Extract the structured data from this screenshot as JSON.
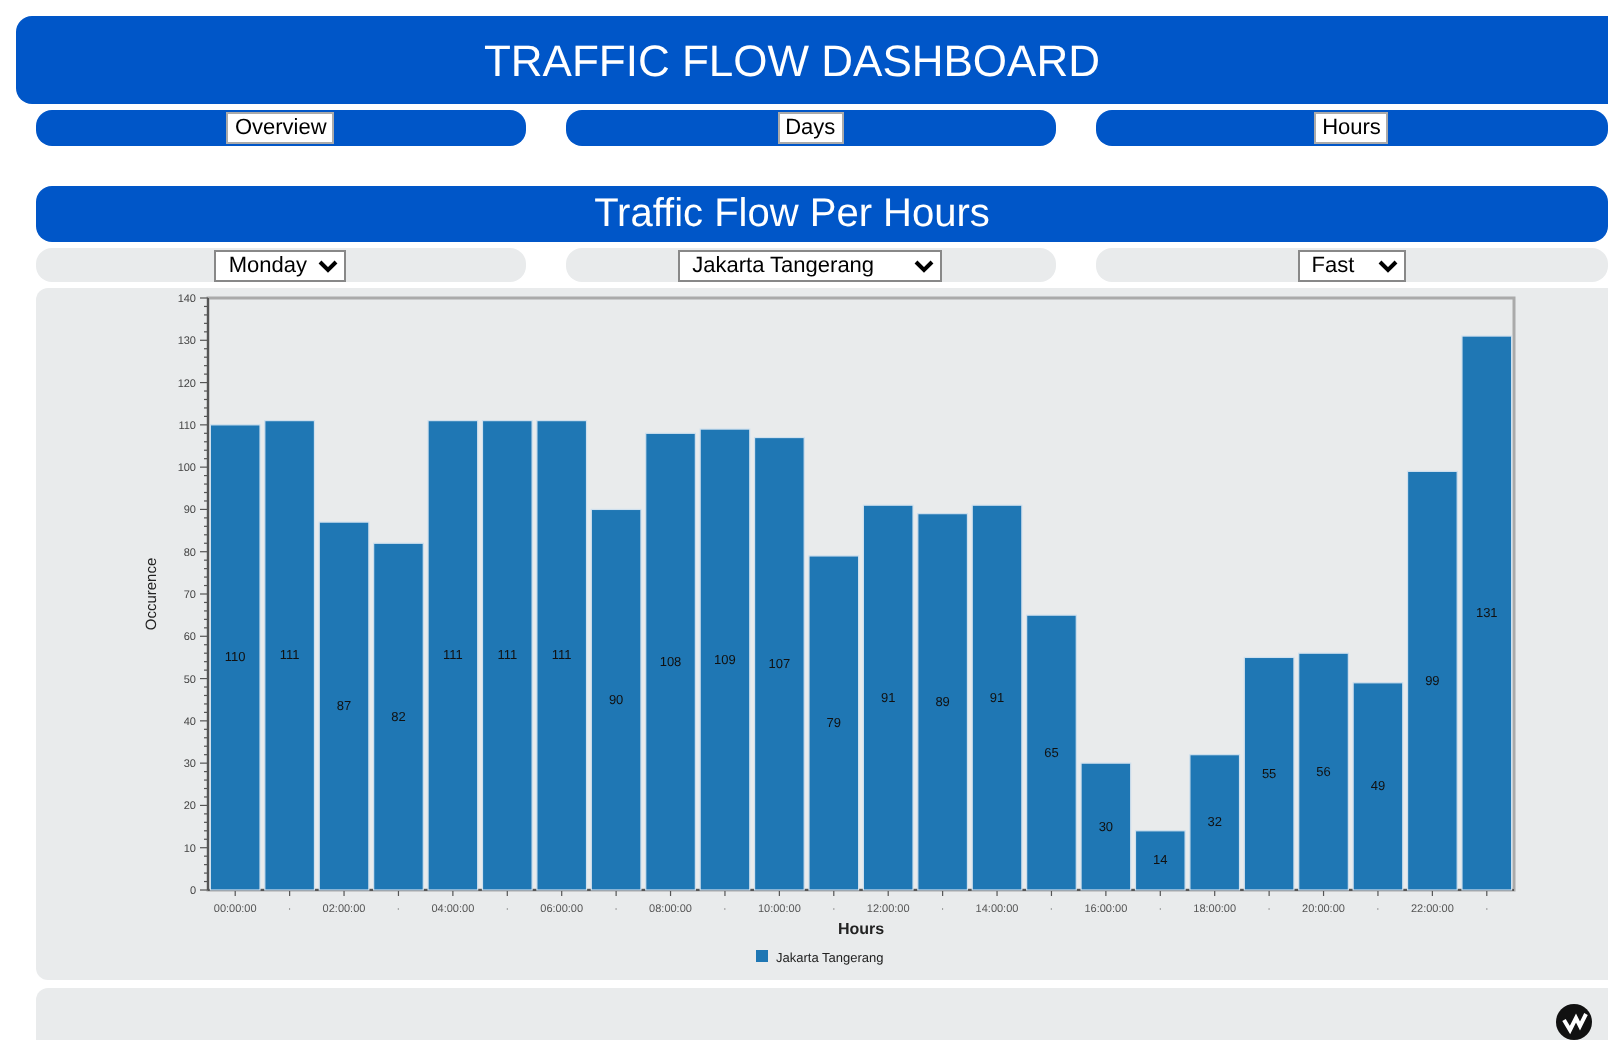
{
  "header": {
    "title": "TRAFFIC FLOW DASHBOARD"
  },
  "nav": [
    {
      "label": "Overview"
    },
    {
      "label": "Days"
    },
    {
      "label": "Hours"
    }
  ],
  "section": {
    "title": "Traffic Flow Per Hours"
  },
  "filters": [
    {
      "value": "Monday"
    },
    {
      "value": "Jakarta Tangerang"
    },
    {
      "value": "Fast"
    }
  ],
  "chart_data": {
    "type": "bar",
    "xlabel": "Hours",
    "ylabel": "Occurence",
    "categories": [
      "00:00:00",
      "·",
      "02:00:00",
      "·",
      "04:00:00",
      "·",
      "06:00:00",
      "·",
      "08:00:00",
      "·",
      "10:00:00",
      "·",
      "12:00:00",
      "·",
      "14:00:00",
      "·",
      "16:00:00",
      "·",
      "18:00:00",
      "·",
      "20:00:00",
      "·",
      "22:00:00",
      "·"
    ],
    "series": [
      {
        "name": "Jakarta Tangerang",
        "color": "#1f77b4",
        "values": [
          110,
          111,
          87,
          82,
          111,
          111,
          111,
          90,
          108,
          109,
          107,
          79,
          91,
          89,
          91,
          65,
          30,
          14,
          32,
          55,
          56,
          49,
          99,
          131
        ]
      }
    ],
    "ylim": [
      0,
      140
    ],
    "yticks": [
      0,
      10,
      20,
      30,
      40,
      50,
      60,
      70,
      80,
      90,
      100,
      110,
      120,
      130,
      140
    ],
    "data_labels": true
  }
}
